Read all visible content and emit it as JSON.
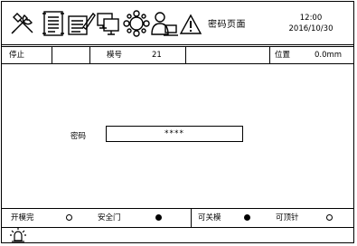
{
  "header": {
    "page_title": "密码页面",
    "time": "12:00",
    "date": "2016/10/30",
    "tools": [
      "tools-icon",
      "document-icon",
      "write-icon",
      "computer-icon",
      "network-icon",
      "user-icon",
      "warning-icon"
    ]
  },
  "status_bar": {
    "state": "停止",
    "mold_label": "模号",
    "mold_value": "21",
    "position_label": "位置",
    "position_value": "0.0mm"
  },
  "password": {
    "label": "密码",
    "value": "****"
  },
  "indicators": [
    {
      "label": "开模完",
      "on": false
    },
    {
      "label": "安全门",
      "on": true
    },
    {
      "label": "可关模",
      "on": true
    },
    {
      "label": "可顶针",
      "on": false
    }
  ],
  "footer": {
    "alarm_icon": "alarm-light-icon"
  }
}
